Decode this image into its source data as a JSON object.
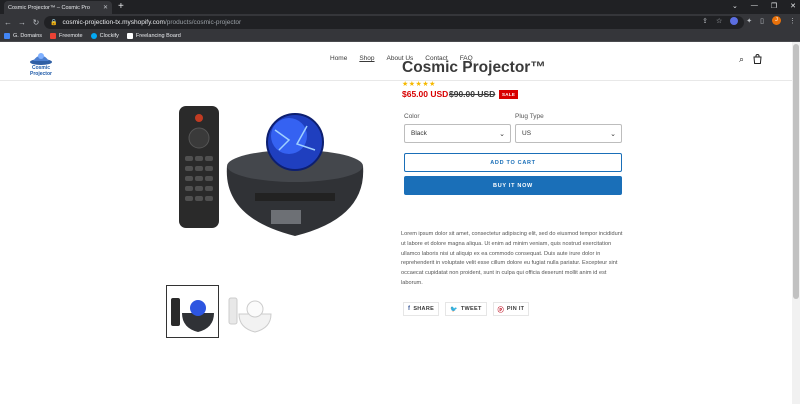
{
  "browser": {
    "tab_title": "Cosmic Projector™ – Cosmic Pro",
    "url_host": "cosmic-projection-tx.myshopify.com",
    "url_path": "/products/cosmic-projector",
    "bookmarks": [
      {
        "label": "G. Domains",
        "color": "#4285f4"
      },
      {
        "label": "Freemote",
        "color": "#e94235"
      },
      {
        "label": "Clockify",
        "color": "#03a9f4"
      },
      {
        "label": "Freelancing Board",
        "color": "#ffffff"
      }
    ],
    "avatar_letter": "J"
  },
  "store": {
    "logo_text": "Cosmic Projector",
    "nav": [
      "Home",
      "Shop",
      "About Us",
      "Contact",
      "FAQ"
    ],
    "active_nav": "Shop"
  },
  "product": {
    "title": "Cosmic Projector™",
    "stars": "★★★★★",
    "rating": 5,
    "price": "$65.00 USD",
    "compare_price": "$90.00 USD",
    "sale_badge": "SALE",
    "color_label": "Color",
    "color_value": "Black",
    "plug_label": "Plug Type",
    "plug_value": "US",
    "add_to_cart": "ADD TO CART",
    "buy_now": "BUY IT NOW",
    "description": "Lorem ipsum dolor sit amet, consectetur adipiscing elit, sed do eiusmod tempor incididunt ut labore et dolore magna aliqua. Ut enim ad minim veniam, quis nostrud exercitation ullamco laboris nisi ut aliquip ex ea commodo consequat. Duis aute irure dolor in reprehenderit in voluptate velit esse cillum dolore eu fugiat nulla pariatur. Excepteur sint occaecat cupidatat non proident, sunt in culpa qui officia deserunt mollit anim id est laborum.",
    "share": {
      "share": "SHARE",
      "tweet": "TWEET",
      "pin": "PIN IT"
    }
  }
}
